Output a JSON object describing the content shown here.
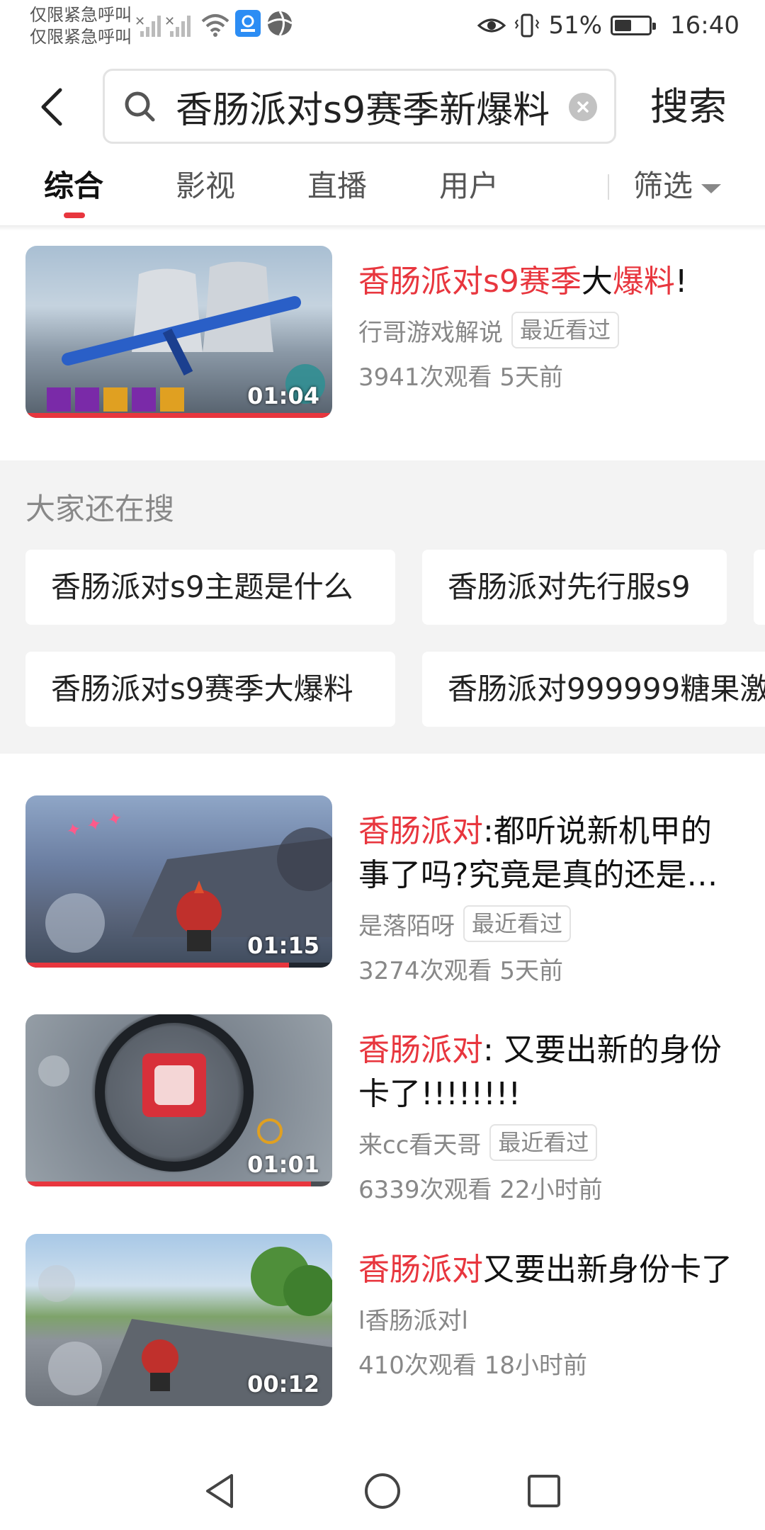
{
  "status_bar": {
    "carrier_line1": "仅限紧急呼叫",
    "carrier_line2": "仅限紧急呼叫",
    "battery_percent": "51%",
    "battery_level": 0.51,
    "time": "16:40"
  },
  "search": {
    "query": "香肠派对s9赛季新爆料",
    "search_button": "搜索"
  },
  "tabs": [
    "综合",
    "影视",
    "直播",
    "用户"
  ],
  "filter_label": "筛选",
  "colors": {
    "accent": "#e8363e",
    "text_secondary": "#888888",
    "section_bg": "#f3f3f3"
  },
  "videos": [
    {
      "title_highlight_1": "香肠派对s9赛季",
      "title_plain_1": "大",
      "title_highlight_2": "爆料",
      "title_plain_2": "!",
      "author": "行哥游戏解说",
      "badge": "最近看过",
      "stats": "3941次观看  5天前",
      "duration": "01:04",
      "watched_fraction": 1.0
    },
    {
      "title_highlight": "香肠派对",
      "title_rest": ":都听说新机甲的事了吗?究竟是真的还是…",
      "author": "是落陌呀",
      "badge": "最近看过",
      "stats": "3274次观看  5天前",
      "duration": "01:15",
      "watched_fraction": 0.86
    },
    {
      "title_highlight": "香肠派对",
      "title_rest": ": 又要出新的身份卡了!!!!!!!!",
      "author": "来cc看天哥",
      "badge": "最近看过",
      "stats": "6339次观看  22小时前",
      "duration": "01:01",
      "watched_fraction": 0.93
    },
    {
      "title_highlight": "香肠派对",
      "title_rest": "又要出新身份卡了",
      "author": "l香肠派对l",
      "stats": "410次观看  18小时前",
      "duration": "00:12"
    }
  ],
  "suggestions": {
    "title": "大家还在搜",
    "items": [
      "香肠派对s9主题是什么",
      "香肠派对先行服s9",
      "香肠派对s9赛季大爆料",
      "香肠派对999999糖果激"
    ]
  }
}
